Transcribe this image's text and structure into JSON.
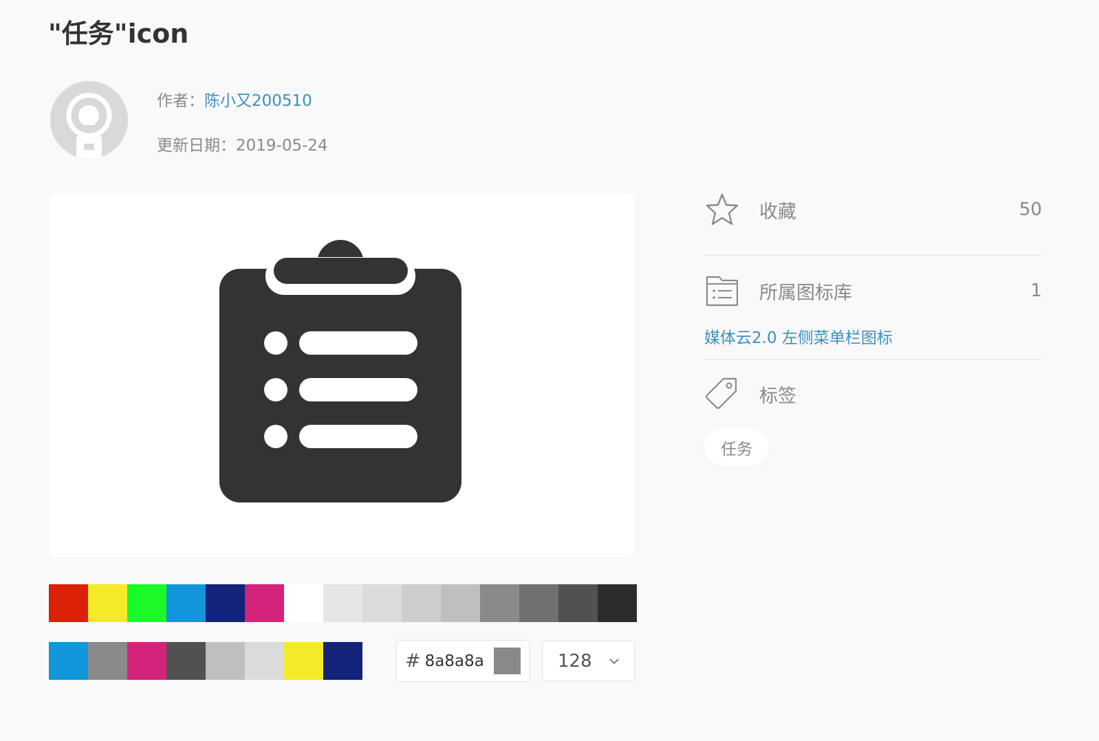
{
  "title": "\"任务\"icon",
  "meta": {
    "author_label": "作者：",
    "author_name": "陈小又200510",
    "date_label": "更新日期：",
    "date_value": "2019-05-24"
  },
  "preview": {
    "icon": "clipboard-list-icon",
    "icon_color": "#333333"
  },
  "palette": {
    "row1": [
      "#db2209",
      "#f4ea2a",
      "#1afa29",
      "#1296db",
      "#13227a",
      "#d4237a",
      "#ffffff",
      "#e6e6e6",
      "#dbdbdb",
      "#cdcdcd",
      "#bfbfbf",
      "#8a8a8a",
      "#707070",
      "#515151",
      "#2c2c2c"
    ],
    "row2": [
      "#1296db",
      "#8a8a8a",
      "#d4237a",
      "#515151",
      "#bfbfbf",
      "#dbdbdb",
      "#f4ea2a",
      "#13227a"
    ]
  },
  "color_input": {
    "hash": "#",
    "value": "8a8a8a",
    "preview_color": "#8a8a8a"
  },
  "size_select": {
    "value": "128"
  },
  "sidebar": {
    "favorites": {
      "icon": "star-icon",
      "label": "收藏",
      "count": "50"
    },
    "library": {
      "icon": "folder-list-icon",
      "label": "所属图标库",
      "count": "1",
      "link": "媒体云2.0 左侧菜单栏图标"
    },
    "tags": {
      "icon": "tag-icon",
      "label": "标签",
      "items": [
        "任务"
      ]
    }
  },
  "colors": {
    "link": "#3c8fbf",
    "muted": "#8a8a8a",
    "background": "#f9f9f9"
  }
}
